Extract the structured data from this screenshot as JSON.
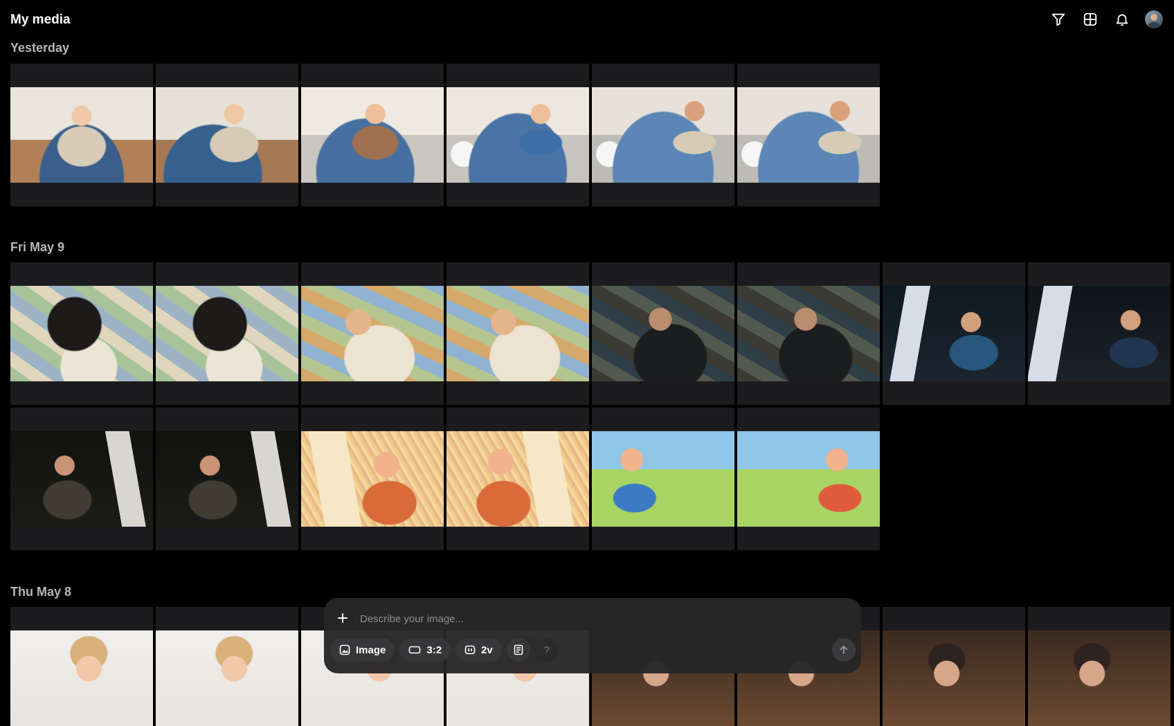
{
  "app_title": "My media",
  "sections": [
    {
      "title": "Yesterday"
    },
    {
      "title": "Fri May 9"
    },
    {
      "title": "Thu May 8"
    }
  ],
  "top_icons": [
    "filter-icon",
    "grid-icon",
    "bell-icon",
    "avatar"
  ],
  "prompt": {
    "placeholder": "Describe your image...",
    "chips": {
      "mode": "Image",
      "ratio": "3:2",
      "version": "2v",
      "help": "?"
    }
  },
  "colors": {
    "background": "#000000",
    "tile": "#1c1c1f",
    "prompt_bar": "#262628",
    "chip": "#37373a",
    "section_title": "#b7b7bb"
  }
}
